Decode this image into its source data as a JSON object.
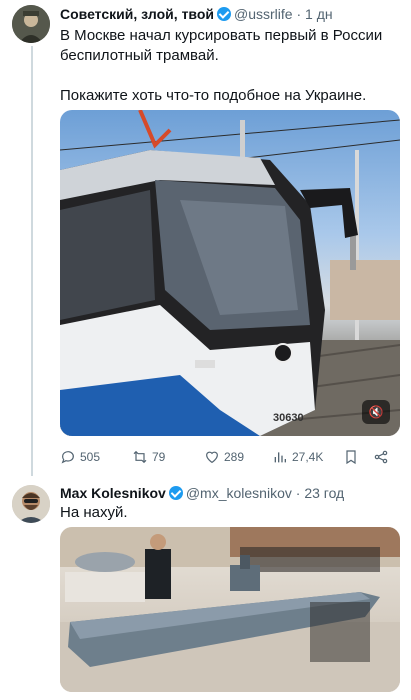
{
  "tweet1": {
    "author_name": "Советский, злой, твой",
    "handle": "@ussrlife",
    "separator": "·",
    "time": "1 дн",
    "text_line1": "В Москве начал курсировать первый в России",
    "text_line2": "беспилотный трамвай.",
    "text_line3": "Покажите хоть что-то подобное на Украине.",
    "tram_number": "30630",
    "actions": {
      "replies": "505",
      "reposts": "79",
      "likes": "289",
      "views": "27,4K"
    }
  },
  "tweet2": {
    "author_name": "Max Kolesnikov",
    "handle": "@mx_kolesnikov",
    "separator": "·",
    "time": "23 год",
    "text": "На нахуй."
  },
  "colors": {
    "verified": "#1d9bf0",
    "secondary_text": "#536471",
    "thread_line": "#cfd9de"
  }
}
